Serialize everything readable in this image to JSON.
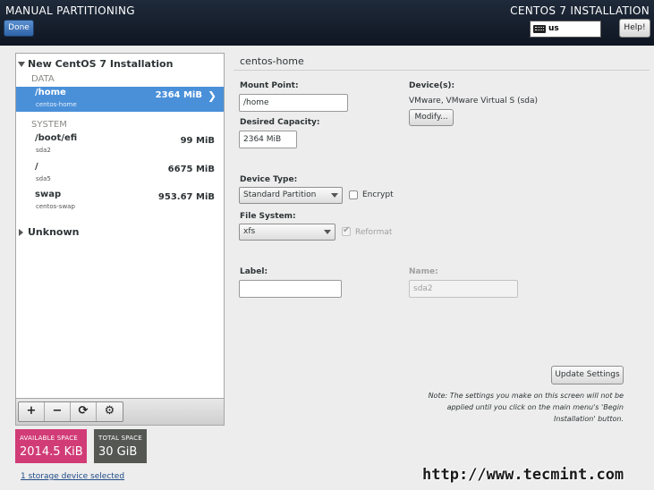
{
  "header": {
    "title": "MANUAL PARTITIONING",
    "done_label": "Done",
    "install_title": "CENTOS 7 INSTALLATION",
    "keyboard_layout": "us",
    "help_label": "Help!"
  },
  "tree": {
    "root_label": "New CentOS 7 Installation",
    "groups": [
      {
        "name": "DATA",
        "items": [
          {
            "mount": "/home",
            "device": "centos-home",
            "size": "2364 MiB",
            "selected": true
          }
        ]
      },
      {
        "name": "SYSTEM",
        "items": [
          {
            "mount": "/boot/efi",
            "device": "sda2",
            "size": "99 MiB",
            "selected": false
          },
          {
            "mount": "/",
            "device": "sda5",
            "size": "6675 MiB",
            "selected": false
          },
          {
            "mount": "swap",
            "device": "centos-swap",
            "size": "953.67 MiB",
            "selected": false
          }
        ]
      }
    ],
    "unknown_label": "Unknown"
  },
  "toolbar": {
    "add": "+",
    "remove": "−",
    "refresh": "⟳",
    "configure": "⚙"
  },
  "space": {
    "available_label": "AVAILABLE SPACE",
    "available_value": "2014.5 KiB",
    "total_label": "TOTAL SPACE",
    "total_value": "30 GiB",
    "storage_link": "1 storage device selected"
  },
  "detail": {
    "title": "centos-home",
    "mount_point_label": "Mount Point:",
    "mount_point_value": "/home",
    "desired_capacity_label": "Desired Capacity:",
    "desired_capacity_value": "2364 MiB",
    "devices_label": "Device(s):",
    "devices_value": "VMware, VMware Virtual S (sda)",
    "modify_label": "Modify...",
    "device_type_label": "Device Type:",
    "device_type_value": "Standard Partition",
    "encrypt_label": "Encrypt",
    "file_system_label": "File System:",
    "file_system_value": "xfs",
    "reformat_label": "Reformat",
    "label_label": "Label:",
    "label_value": "",
    "name_label": "Name:",
    "name_value": "sda2",
    "update_label": "Update Settings",
    "note": "Note:  The settings you make on this screen will not be applied until you click on the main menu's 'Begin Installation' button."
  },
  "watermark": "http://www.tecmint.com"
}
